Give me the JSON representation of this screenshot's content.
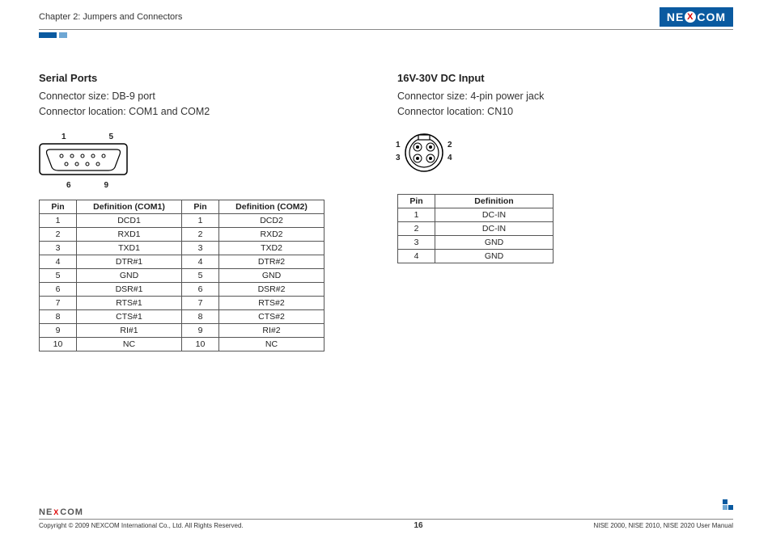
{
  "header": {
    "chapter": "Chapter 2: Jumpers and Connectors",
    "logo_left": "NE",
    "logo_x": "X",
    "logo_right": "COM"
  },
  "left": {
    "title": "Serial Ports",
    "size": "Connector size: DB-9 port",
    "location": "Connector location: COM1 and COM2",
    "db9_labels": {
      "tl": "1",
      "tr": "5",
      "bl": "6",
      "br": "9"
    },
    "table": {
      "headers": [
        "Pin",
        "Definition (COM1)",
        "Pin",
        "Definition (COM2)"
      ],
      "rows": [
        [
          "1",
          "DCD1",
          "1",
          "DCD2"
        ],
        [
          "2",
          "RXD1",
          "2",
          "RXD2"
        ],
        [
          "3",
          "TXD1",
          "3",
          "TXD2"
        ],
        [
          "4",
          "DTR#1",
          "4",
          "DTR#2"
        ],
        [
          "5",
          "GND",
          "5",
          "GND"
        ],
        [
          "6",
          "DSR#1",
          "6",
          "DSR#2"
        ],
        [
          "7",
          "RTS#1",
          "7",
          "RTS#2"
        ],
        [
          "8",
          "CTS#1",
          "8",
          "CTS#2"
        ],
        [
          "9",
          "RI#1",
          "9",
          "RI#2"
        ],
        [
          "10",
          "NC",
          "10",
          "NC"
        ]
      ]
    }
  },
  "right": {
    "title": "16V-30V DC Input",
    "size": "Connector size: 4-pin power jack",
    "location": "Connector location: CN10",
    "pin_labels": {
      "p1": "1",
      "p2": "2",
      "p3": "3",
      "p4": "4"
    },
    "table": {
      "headers": [
        "Pin",
        "Definition"
      ],
      "rows": [
        [
          "1",
          "DC-IN"
        ],
        [
          "2",
          "DC-IN"
        ],
        [
          "3",
          "GND"
        ],
        [
          "4",
          "GND"
        ]
      ]
    }
  },
  "footer": {
    "logo_left": "NE",
    "logo_x": "X",
    "logo_right": "COM",
    "copyright": "Copyright © 2009 NEXCOM International Co., Ltd. All Rights Reserved.",
    "page": "16",
    "manual": "NISE 2000, NISE 2010, NISE 2020 User Manual"
  }
}
